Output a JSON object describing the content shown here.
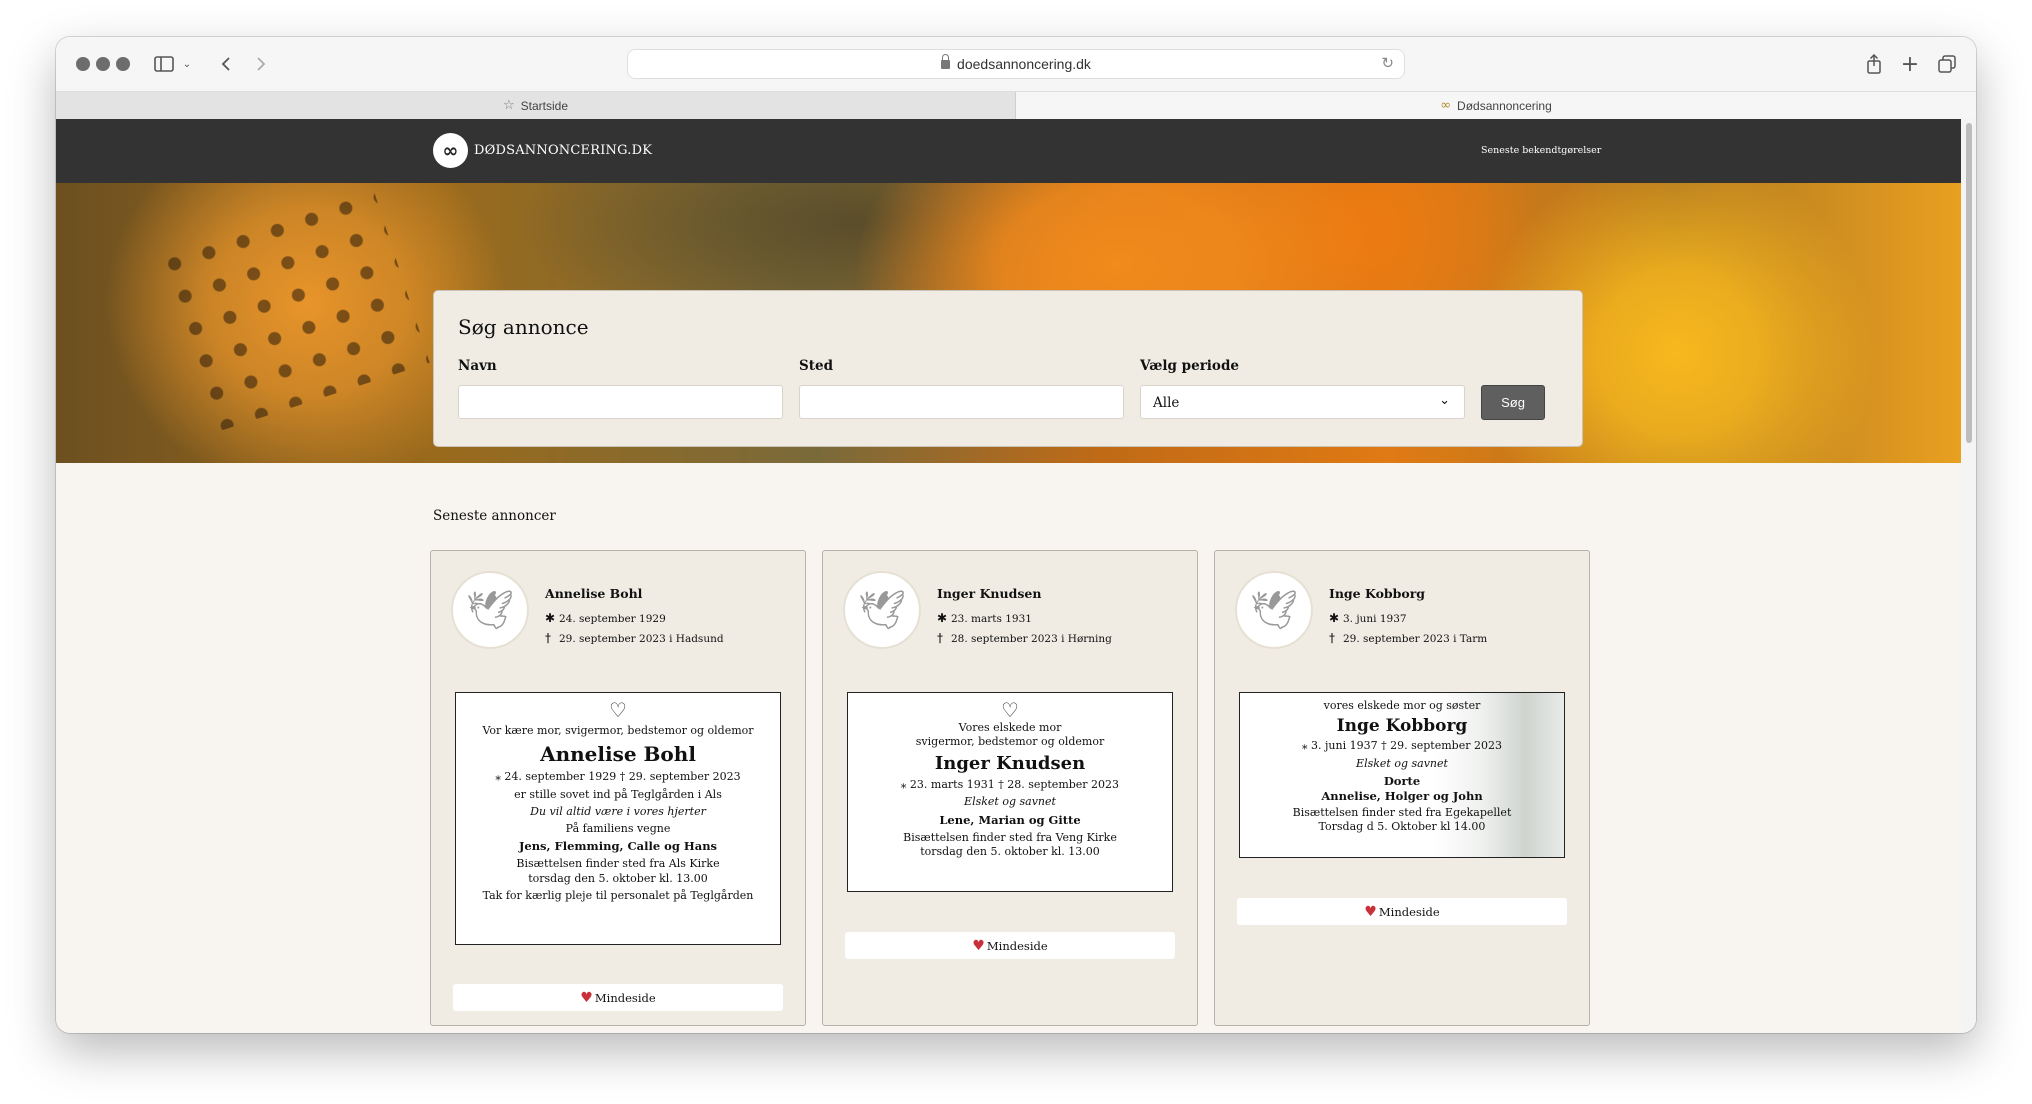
{
  "browser": {
    "url": "doedsannoncering.dk",
    "tabs": [
      {
        "label": "Startside",
        "icon": "star-icon"
      },
      {
        "label": "Dødsannoncering",
        "icon": "infinity-icon"
      }
    ]
  },
  "site": {
    "logo_text": "DØDSANNONCERING.DK",
    "nav_link": "Seneste bekendtgørelser"
  },
  "search": {
    "title": "Søg annonce",
    "name_label": "Navn",
    "name_value": "",
    "place_label": "Sted",
    "place_value": "",
    "period_label": "Vælg periode",
    "period_value": "Alle",
    "button_label": "Søg"
  },
  "listing": {
    "title": "Seneste annoncer",
    "cards": [
      {
        "name": "Annelise Bohl",
        "born": "24. september 1929",
        "died": "29. september 2023 i Hadsund",
        "ad": {
          "intro": "Vor kære mor, svigermor, bedstemor og oldemor",
          "name": "Annelise Bohl",
          "dates": "⁎ 24. september 1929   † 29. september 2023",
          "line1": "er stille sovet ind på Teglgården i Als",
          "italic": "Du vil altid være i vores hjerter",
          "line2": "På familiens vegne",
          "family": "Jens, Flemming, Calle og Hans",
          "funeral1": "Bisættelsen finder sted fra Als Kirke",
          "funeral2": "torsdag den 5. oktober kl. 13.00",
          "thanks": "Tak for kærlig pleje til personalet på Teglgården"
        },
        "memorial": "Mindeside"
      },
      {
        "name": "Inger Knudsen",
        "born": "23. marts 1931",
        "died": "28. september 2023 i Hørning",
        "ad": {
          "intro1": "Vores elskede mor",
          "intro2": "svigermor, bedstemor og oldemor",
          "name": "Inger Knudsen",
          "dates": "⁎ 23. marts 1931   † 28. september 2023",
          "italic": "Elsket og savnet",
          "family": "Lene, Marian og Gitte",
          "funeral1": "Bisættelsen finder sted fra Veng Kirke",
          "funeral2": "torsdag den 5. oktober kl. 13.00"
        },
        "memorial": "Mindeside"
      },
      {
        "name": "Inge Kobborg",
        "born": "3. juni 1937",
        "died": "29. september 2023 i Tarm",
        "ad": {
          "intro": "vores elskede mor og søster",
          "name": "Inge Kobborg",
          "dates": "⁎ 3. juni 1937 † 29. september 2023",
          "italic": "Elsket og savnet",
          "family1": "Dorte",
          "family2": "Annelise, Holger og John",
          "funeral1": "Bisættelsen finder sted fra Egekapellet",
          "funeral2": "Torsdag d 5. Oktober kl 14.00"
        },
        "memorial": "Mindeside"
      }
    ]
  }
}
